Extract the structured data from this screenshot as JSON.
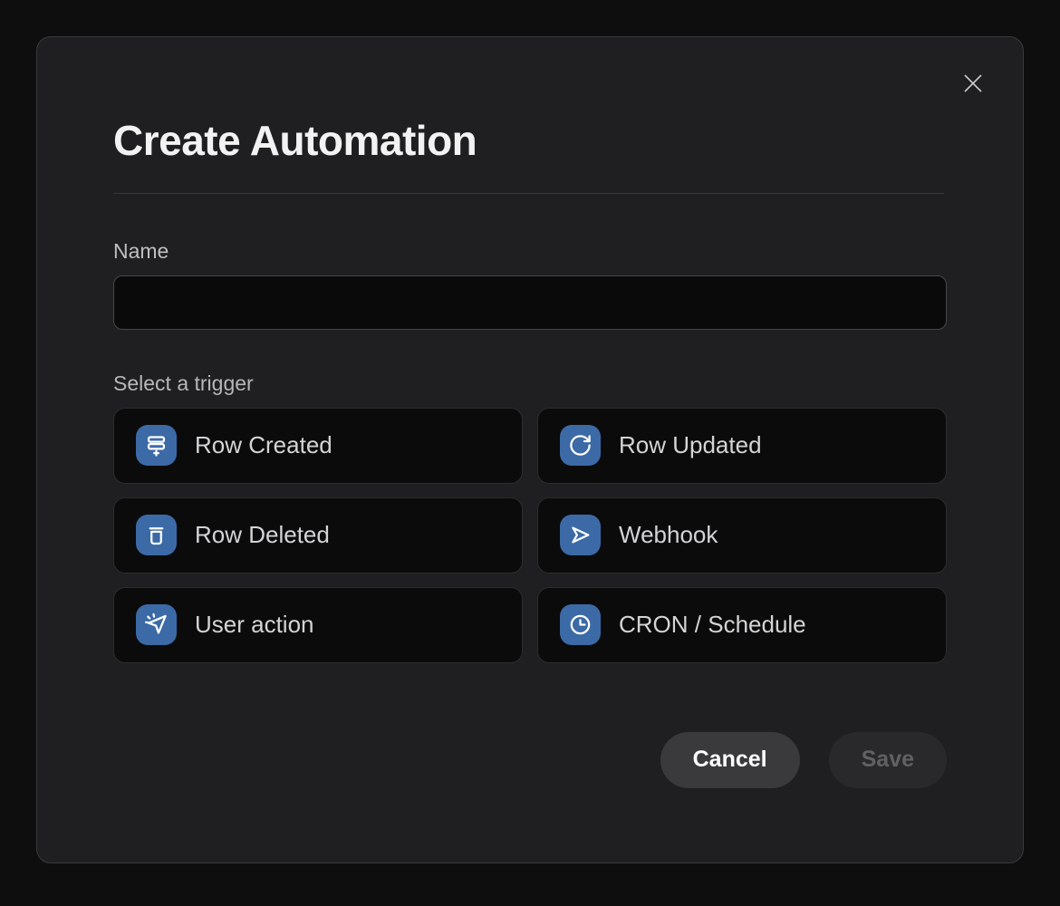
{
  "modal": {
    "title": "Create Automation"
  },
  "form": {
    "name_label": "Name",
    "name_value": "",
    "trigger_section_label": "Select a trigger",
    "triggers": [
      {
        "label": "Row Created",
        "icon": "rows-plus-icon"
      },
      {
        "label": "Row Updated",
        "icon": "refresh-icon"
      },
      {
        "label": "Row Deleted",
        "icon": "trash-icon"
      },
      {
        "label": "Webhook",
        "icon": "send-icon"
      },
      {
        "label": "User action",
        "icon": "cursor-click-icon"
      },
      {
        "label": "CRON / Schedule",
        "icon": "clock-icon"
      }
    ]
  },
  "footer": {
    "cancel_label": "Cancel",
    "save_label": "Save",
    "save_disabled": true
  },
  "colors": {
    "accent_blue": "#3c6aa6",
    "modal_background": "#1f1f21",
    "page_background": "#0e0e0f",
    "button_background": "#0b0b0c",
    "cancel_background": "#3a3a3c",
    "save_background": "#29292b"
  }
}
